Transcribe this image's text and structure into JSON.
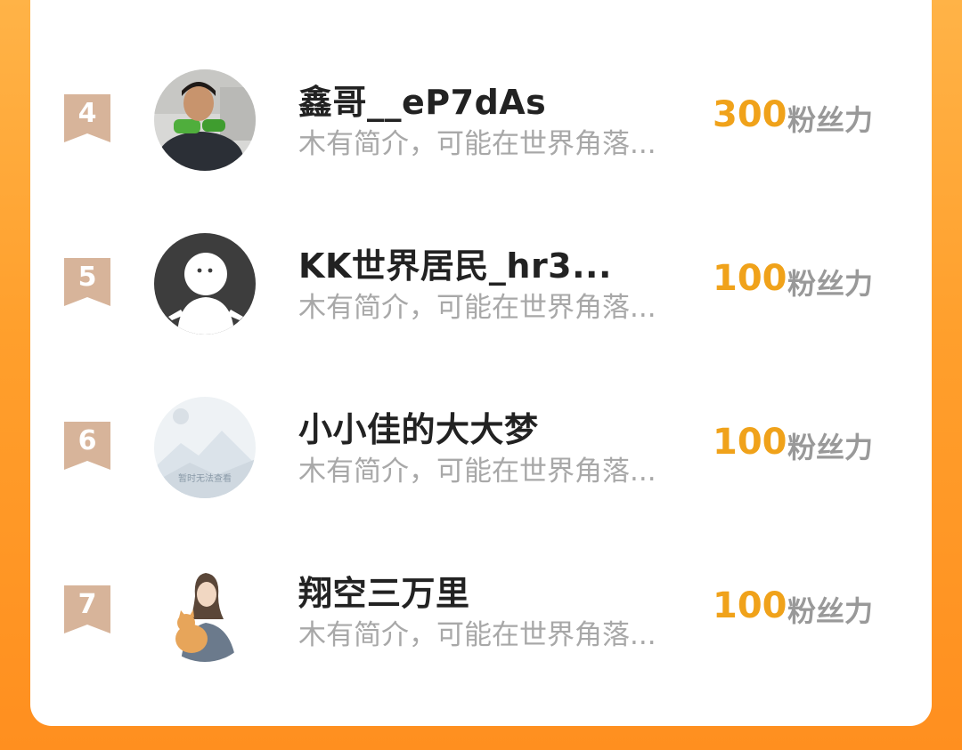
{
  "colors": {
    "background": "#ff9f2c",
    "card": "#ffffff",
    "rank_badge": "#d7b49a",
    "score": "#f0a21a",
    "unit": "#999999",
    "bio": "#a8a8a8",
    "name": "#222222"
  },
  "ranking": {
    "unit_label": "粉丝力",
    "items": [
      {
        "rank": "4",
        "name": "鑫哥__eP7dAs",
        "bio": "木有简介，可能在世界角落...",
        "score": "300",
        "avatar": "photo-girl-avatar"
      },
      {
        "rank": "5",
        "name": "KK世界居民_hr3...",
        "bio": "木有简介，可能在世界角落...",
        "score": "100",
        "avatar": "default-person-avatar"
      },
      {
        "rank": "6",
        "name": "小小佳的大大梦",
        "bio": "木有简介，可能在世界角落...",
        "score": "100",
        "avatar": "image-unavailable-avatar",
        "avatar_caption": "暂时无法查看"
      },
      {
        "rank": "7",
        "name": "翔空三万里",
        "bio": "木有简介，可能在世界角落...",
        "score": "100",
        "avatar": "illustration-cat-avatar"
      }
    ]
  }
}
